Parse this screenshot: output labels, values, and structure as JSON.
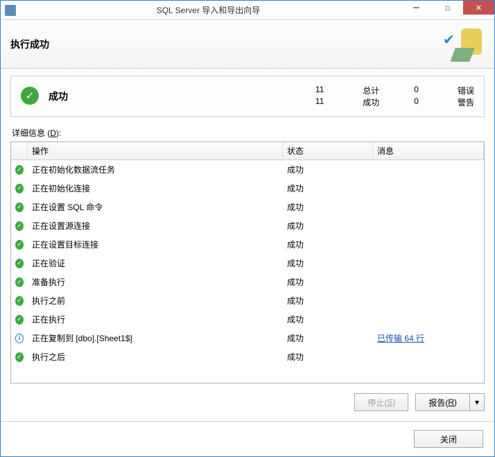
{
  "window": {
    "title": "SQL Server 导入和导出向导"
  },
  "header": {
    "title": "执行成功"
  },
  "summary": {
    "success_label": "成功",
    "total_count": "11",
    "total_label": "总计",
    "error_count": "0",
    "error_label": "错误",
    "success_count": "11",
    "ok_label": "成功",
    "warn_count": "0",
    "warn_label": "警告"
  },
  "details": {
    "label_prefix": "详细信息 (",
    "hotkey": "D",
    "label_suffix": "):"
  },
  "columns": {
    "action": "操作",
    "status": "状态",
    "message": "消息"
  },
  "rows": [
    {
      "icon": "success",
      "action": "正在初始化数据流任务",
      "status": "成功",
      "message": ""
    },
    {
      "icon": "success",
      "action": "正在初始化连接",
      "status": "成功",
      "message": ""
    },
    {
      "icon": "success",
      "action": "正在设置 SQL 命令",
      "status": "成功",
      "message": ""
    },
    {
      "icon": "success",
      "action": "正在设置源连接",
      "status": "成功",
      "message": ""
    },
    {
      "icon": "success",
      "action": "正在设置目标连接",
      "status": "成功",
      "message": ""
    },
    {
      "icon": "success",
      "action": "正在验证",
      "status": "成功",
      "message": ""
    },
    {
      "icon": "success",
      "action": "准备执行",
      "status": "成功",
      "message": ""
    },
    {
      "icon": "success",
      "action": "执行之前",
      "status": "成功",
      "message": ""
    },
    {
      "icon": "success",
      "action": "正在执行",
      "status": "成功",
      "message": ""
    },
    {
      "icon": "info",
      "action": "正在复制到 [dbo].[Sheet1$]",
      "status": "成功",
      "message": "已传输 64 行",
      "message_link": true
    },
    {
      "icon": "success",
      "action": "执行之后",
      "status": "成功",
      "message": ""
    }
  ],
  "buttons": {
    "stop_prefix": "停止(",
    "stop_hotkey": "S",
    "stop_suffix": ")",
    "report_prefix": "报告(",
    "report_hotkey": "R",
    "report_suffix": ")",
    "close": "关闭"
  }
}
